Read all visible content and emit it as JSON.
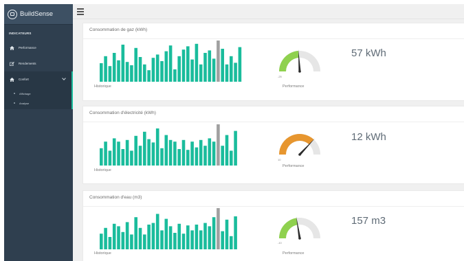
{
  "brand": {
    "name": "BuildSense"
  },
  "sidebar": {
    "section_title": "INDICATEURS",
    "items": [
      {
        "label": "Performance",
        "icon": "house-icon"
      },
      {
        "label": "Rendements",
        "icon": "edit-icon"
      },
      {
        "label": "Confort",
        "icon": "house-icon"
      }
    ],
    "submenu": [
      {
        "label": "Affichage"
      },
      {
        "label": "Analyse"
      }
    ]
  },
  "colors": {
    "accent": "#1abc9c",
    "sidebar": "#2f3f4f",
    "bar": "#1abc9c",
    "bar_highlight": "#a0a0a0",
    "gauge_green": "#8fd14f",
    "gauge_orange": "#e7962f",
    "gauge_track": "#e6e6e6"
  },
  "panels": [
    {
      "title": "Consommation de gaz (kWh)",
      "history_label": "Historique",
      "performance_label": "Performance",
      "gauge_min": "-25",
      "gauge_fraction": 0.48,
      "gauge_color": "#8fd14f",
      "value": "57 kWh",
      "bars": [
        0.45,
        0.62,
        0.38,
        0.7,
        0.52,
        0.9,
        0.48,
        0.4,
        0.82,
        0.6,
        0.42,
        0.28,
        0.58,
        0.66,
        0.5,
        0.74,
        0.88,
        0.3,
        0.62,
        0.78,
        0.86,
        0.54,
        0.92,
        0.42,
        0.7,
        0.76,
        0.56,
        1.0,
        0.8,
        0.42,
        0.62,
        0.46,
        0.84
      ],
      "highlight_index": 27
    },
    {
      "title": "Consommation d'électricité (kWh)",
      "history_label": "Historique",
      "performance_label": "Performance",
      "gauge_min": "10",
      "gauge_fraction": 0.74,
      "gauge_color": "#e7962f",
      "value": "12 kWh",
      "bars": [
        0.42,
        0.58,
        0.36,
        0.66,
        0.58,
        0.4,
        0.62,
        0.36,
        0.72,
        0.48,
        0.82,
        0.64,
        0.56,
        0.9,
        0.42,
        0.74,
        0.62,
        0.58,
        0.4,
        0.62,
        0.38,
        0.58,
        0.44,
        0.62,
        0.48,
        0.66,
        0.58,
        1.0,
        0.48,
        0.74,
        0.36,
        0.84
      ],
      "highlight_index": 27
    },
    {
      "title": "Consommation d'eau (m3)",
      "history_label": "Historique",
      "performance_label": "Performance",
      "gauge_min": "-10",
      "gauge_fraction": 0.45,
      "gauge_color": "#8fd14f",
      "value": "157 m3",
      "bars": [
        0.38,
        0.52,
        0.3,
        0.62,
        0.56,
        0.42,
        0.66,
        0.36,
        0.78,
        0.52,
        0.36,
        0.6,
        0.64,
        0.86,
        0.46,
        0.74,
        0.56,
        0.4,
        0.62,
        0.38,
        0.58,
        0.46,
        0.6,
        0.46,
        0.64,
        0.56,
        0.78,
        1.0,
        0.44,
        0.72,
        0.32,
        0.8
      ],
      "highlight_index": 27
    }
  ]
}
